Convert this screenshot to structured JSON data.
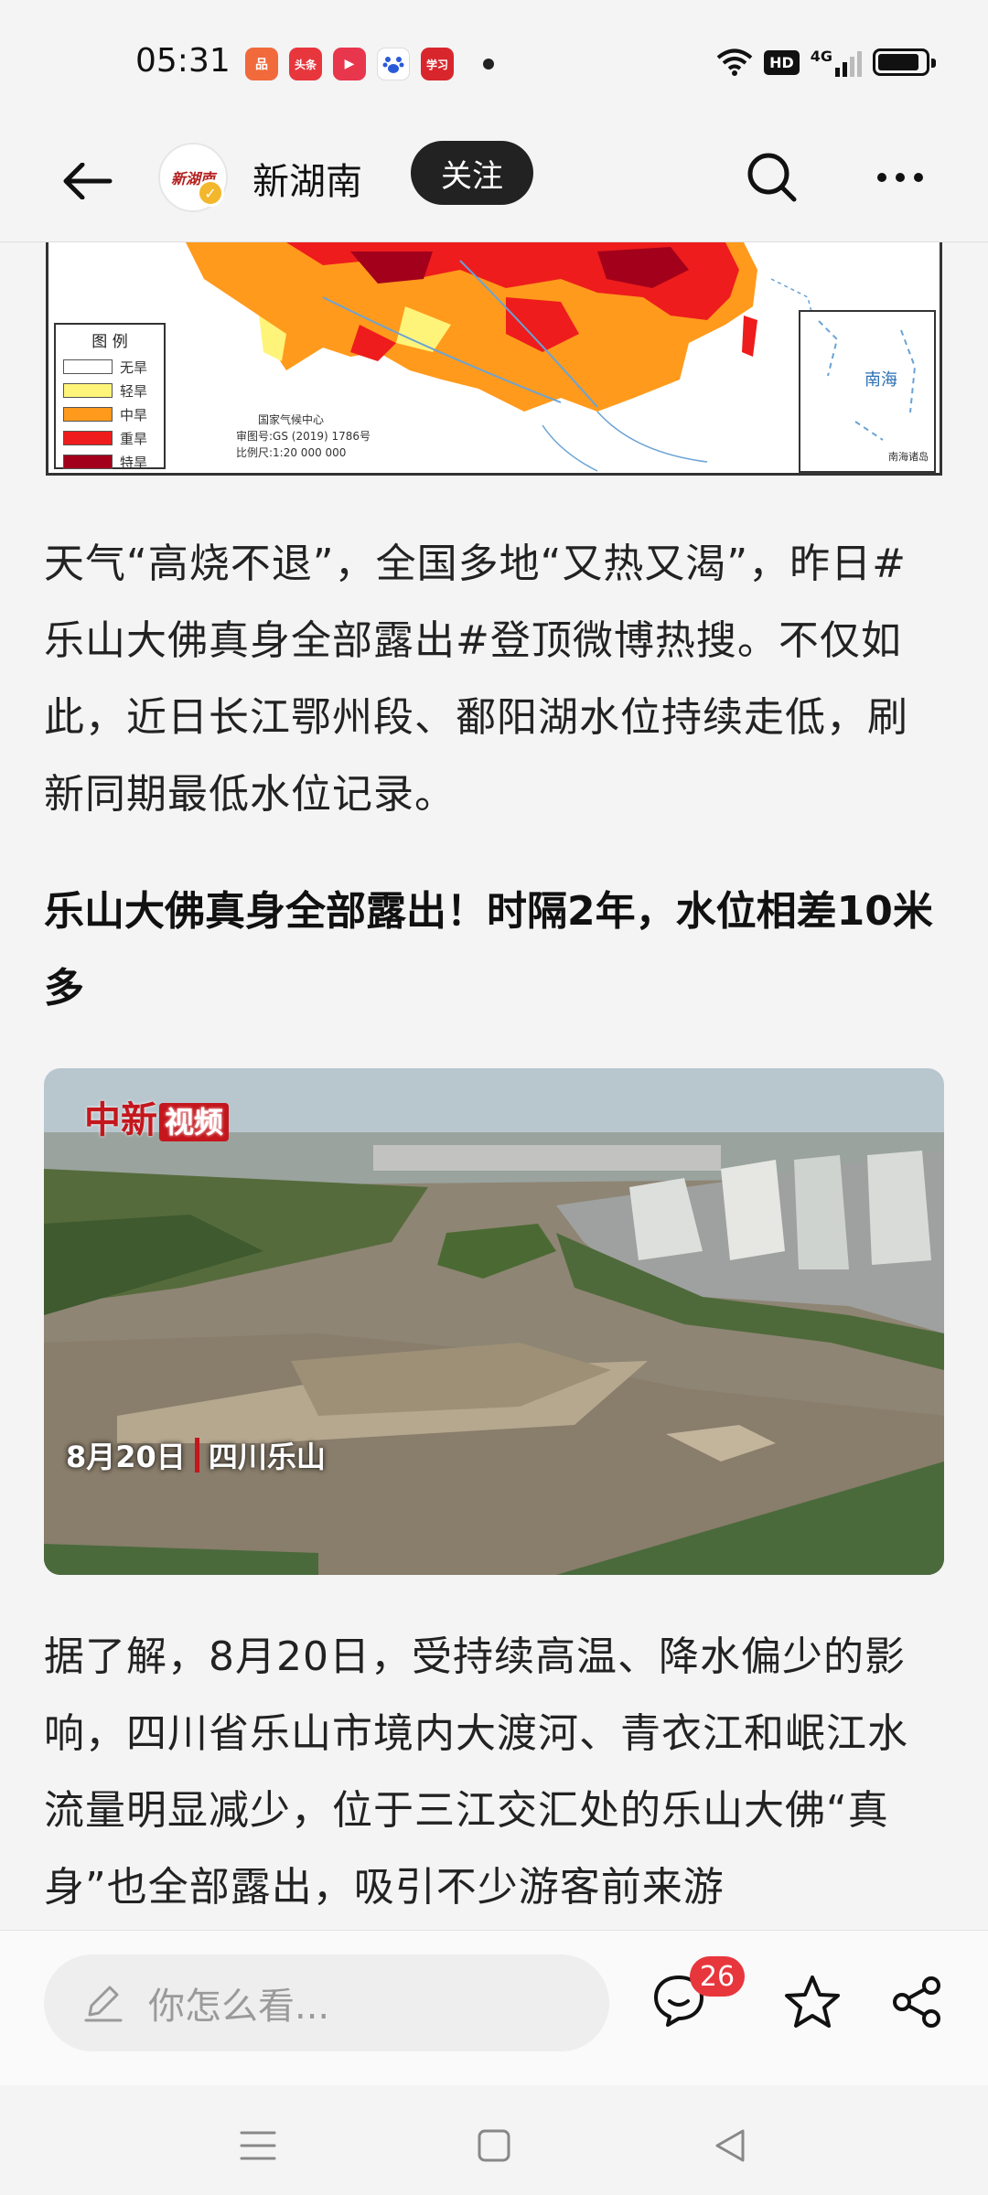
{
  "status_bar": {
    "time": "05:31",
    "notifications": [
      {
        "name": "app-icon-1",
        "color": "#f06a3b",
        "text": "品"
      },
      {
        "name": "toutiao-icon",
        "color": "#e8363d",
        "text": "头条"
      },
      {
        "name": "video-icon",
        "color": "#e8364d",
        "text": "▶"
      },
      {
        "name": "baidu-icon",
        "color": "#ffffff",
        "text": "🐾"
      },
      {
        "name": "xuexi-icon",
        "color": "#d8262c",
        "text": "学习"
      }
    ],
    "hd_label": "HD",
    "network_label": "4G"
  },
  "header": {
    "avatar_text": "新湖南",
    "account_name": "新湖南",
    "follow_label": "关注"
  },
  "map": {
    "legend_title": "图 例",
    "legend": [
      {
        "label": "无旱",
        "color": "#ffffff"
      },
      {
        "label": "轻旱",
        "color": "#fff47a"
      },
      {
        "label": "中旱",
        "color": "#ff9a1c"
      },
      {
        "label": "重旱",
        "color": "#ee1c1c"
      },
      {
        "label": "特旱",
        "color": "#a3001b"
      }
    ],
    "source": "国家气候中心",
    "map_number": "审图号:GS (2019) 1786号",
    "scale": "比例尺:1:20 000 000",
    "inset_label": "南海",
    "inset_caption": "南海诸岛"
  },
  "article": {
    "para1": "天气“高烧不退”，全国多地“又热又渴”，昨日#乐山大佛真身全部露出#登顶微博热搜。不仅如此，近日长江鄂州段、鄱阳湖水位持续走低，刷新同期最低水位记录。",
    "subhead": "乐山大佛真身全部露出！时隔2年，水位相差10米多",
    "photo_logo": "中新",
    "photo_logo_badge": "视频",
    "photo_date": "8月20日",
    "photo_place": "四川乐山",
    "para2": "据了解，8月20日，受持续高温、降水偏少的影响，四川省乐山市境内大渡河、青衣江和岷江水流量明显减少，位于三江交汇处的乐山大佛“真身”也全部露出，吸引不少游客前来游"
  },
  "bottom_bar": {
    "comment_placeholder": "你怎么看...",
    "comment_count": "26"
  }
}
